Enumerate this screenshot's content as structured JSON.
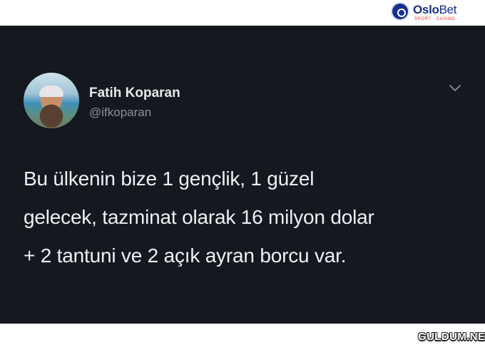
{
  "brand": {
    "name_bold": "Oslo",
    "name_light": "Bet",
    "tagline": "SPORT · CASINO"
  },
  "tweet": {
    "clipped_top_text": "·  ,  ·  ,  ·  ·  ,  ·",
    "author_name": "Fatih Koparan",
    "author_handle": "@ifkoparan",
    "menu_icon": "chevron-down-icon",
    "text": "Bu ülkenin bize 1 gençlik, 1 güzel\ngelecek, tazminat olarak 16 milyon dolar\n+ 2 tantuni ve 2 açık ayran borcu var."
  },
  "watermark": "GULDUM.NET",
  "colors": {
    "tweet_background": "#15181f",
    "name": "#e8e9ec",
    "handle": "#8b8f96",
    "brand": "#1a2f8a",
    "brand_accent": "#e0322e"
  }
}
